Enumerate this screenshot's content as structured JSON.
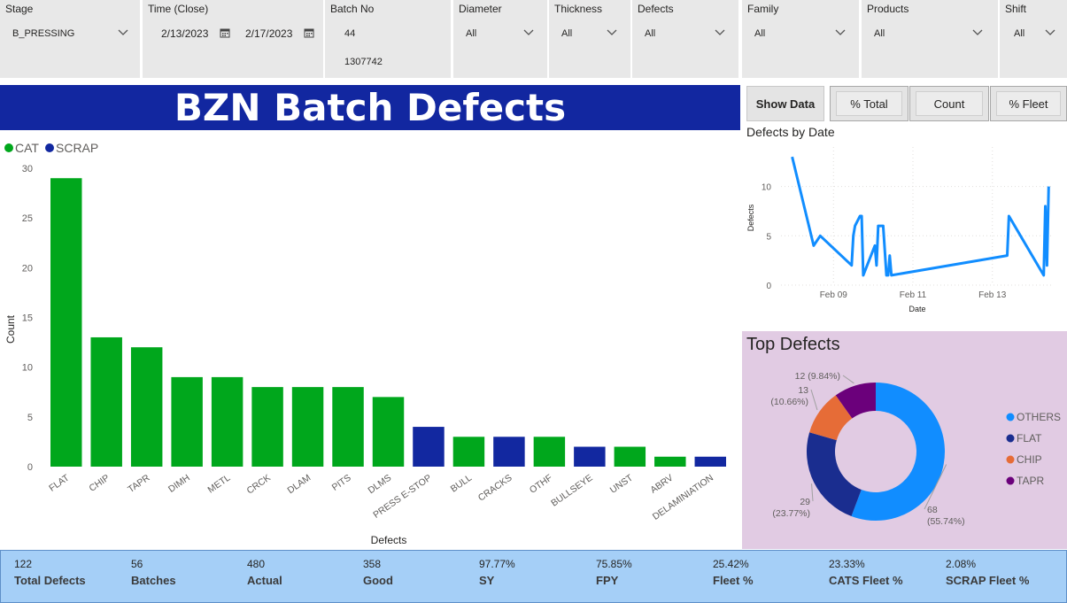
{
  "filters": {
    "stage": {
      "label": "Stage",
      "value": "B_PRESSING"
    },
    "time": {
      "label": "Time (Close)",
      "start": "2/13/2023",
      "end": "2/17/2023"
    },
    "batch": {
      "label": "Batch No",
      "values": [
        "44",
        "1307742"
      ]
    },
    "diameter": {
      "label": "Diameter",
      "value": "All"
    },
    "thickness": {
      "label": "Thickness",
      "value": "All"
    },
    "defects": {
      "label": "Defects",
      "value": "All"
    },
    "family": {
      "label": "Family",
      "value": "All"
    },
    "products": {
      "label": "Products",
      "value": "All"
    },
    "shift": {
      "label": "Shift",
      "value": "All"
    }
  },
  "title": "BZN Batch Defects",
  "buttons": {
    "show_data": "Show Data",
    "pct_total": "% Total",
    "count": "Count",
    "pct_fleet": "% Fleet"
  },
  "colors": {
    "cat": "#00a71c",
    "scrap": "#1228a0",
    "line": "#118dff",
    "others": "#118dff",
    "flat": "#1a2d8f",
    "chip": "#e66c37",
    "tapr": "#6b007b",
    "banner": "#1227a0",
    "kpi_bg": "#a5cff7",
    "panel_bg": "#e1cbe3"
  },
  "chart_data": [
    {
      "type": "bar",
      "title": "",
      "xlabel": "Defects",
      "ylabel": "Count",
      "ylim": [
        0,
        30
      ],
      "yticks": [
        0,
        5,
        10,
        15,
        20,
        25,
        30
      ],
      "legend": {
        "placement": "top-left",
        "entries": [
          {
            "name": "CAT",
            "color": "#00a71c"
          },
          {
            "name": "SCRAP",
            "color": "#1228a0"
          }
        ]
      },
      "categories": [
        "FLAT",
        "CHIP",
        "TAPR",
        "DIMH",
        "METL",
        "CRCK",
        "DLAM",
        "PITS",
        "DLMS",
        "PRESS E-STOP",
        "BULL",
        "CRACKS",
        "OTHF",
        "BULLSEYE",
        "UNST",
        "ABRV",
        "DELAMINIATION"
      ],
      "values": [
        29,
        13,
        12,
        9,
        9,
        8,
        8,
        8,
        7,
        4,
        3,
        3,
        3,
        2,
        2,
        1,
        1
      ],
      "group": [
        "CAT",
        "CAT",
        "CAT",
        "CAT",
        "CAT",
        "CAT",
        "CAT",
        "CAT",
        "CAT",
        "SCRAP",
        "CAT",
        "SCRAP",
        "CAT",
        "SCRAP",
        "CAT",
        "CAT",
        "SCRAP"
      ]
    },
    {
      "type": "line",
      "title": "Defects by Date",
      "xlabel": "Date",
      "ylabel": "Defects",
      "ylim": [
        0,
        14
      ],
      "yticks": [
        0,
        5,
        10
      ],
      "xticks": [
        "Feb 09",
        "Feb 11",
        "Feb 13"
      ],
      "grid": true,
      "x": [
        "2023-02-07 23:00",
        "2023-02-08 12:00",
        "2023-02-08 16:00",
        "2023-02-09 11:00",
        "2023-02-09 12:00",
        "2023-02-09 13:00",
        "2023-02-09 16:00",
        "2023-02-09 17:00",
        "2023-02-09 18:00",
        "2023-02-10 01:00",
        "2023-02-10 02:00",
        "2023-02-10 03:00",
        "2023-02-10 06:00",
        "2023-02-10 08:00",
        "2023-02-10 09:00",
        "2023-02-10 10:00",
        "2023-02-10 11:00",
        "2023-02-13 09:00",
        "2023-02-13 10:00",
        "2023-02-14 07:00",
        "2023-02-14 08:00",
        "2023-02-14 09:00",
        "2023-02-14 10:00"
      ],
      "values": [
        13,
        4,
        5,
        2,
        5,
        6,
        7,
        7,
        1,
        4,
        2,
        6,
        6,
        1,
        1,
        3,
        1,
        3,
        7,
        1,
        8,
        2,
        10
      ]
    },
    {
      "type": "pie",
      "title": "Top Defects",
      "legend": {
        "placement": "right"
      },
      "categories": [
        "OTHERS",
        "FLAT",
        "CHIP",
        "TAPR"
      ],
      "values": [
        68,
        29,
        13,
        12
      ],
      "labels": [
        "68\n(55.74%)",
        "29\n(23.77%)",
        "13\n(10.66%)",
        "12 (9.84%)"
      ]
    }
  ],
  "kpis": [
    {
      "value": "122",
      "label": "Total Defects"
    },
    {
      "value": "56",
      "label": "Batches"
    },
    {
      "value": "480",
      "label": "Actual"
    },
    {
      "value": "358",
      "label": "Good"
    },
    {
      "value": "97.77%",
      "label": "SY"
    },
    {
      "value": "75.85%",
      "label": "FPY"
    },
    {
      "value": "25.42%",
      "label": "Fleet %"
    },
    {
      "value": "23.33%",
      "label": "CATS Fleet %"
    },
    {
      "value": "2.08%",
      "label": "SCRAP Fleet %"
    }
  ]
}
